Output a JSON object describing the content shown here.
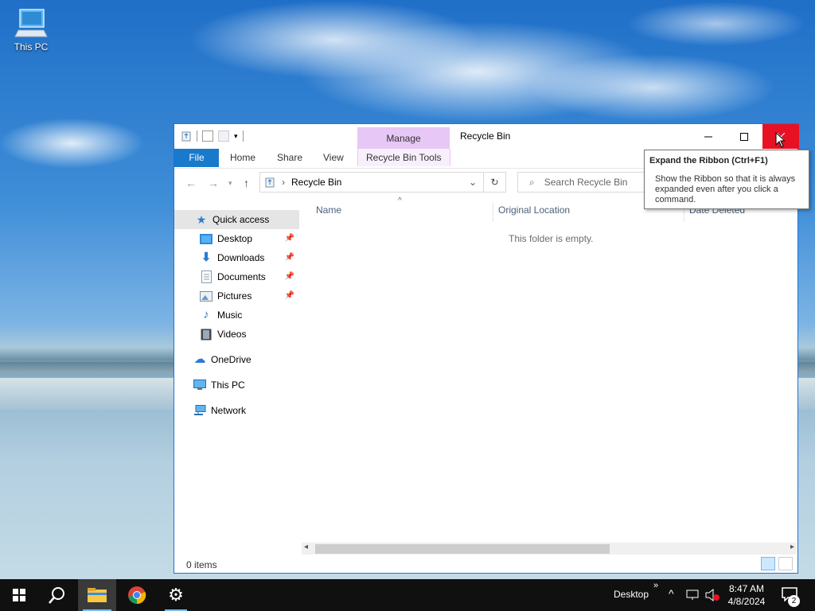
{
  "desktop": {
    "icons": [
      {
        "label": "This PC",
        "icon": "computer-icon"
      }
    ]
  },
  "window": {
    "title": "Recycle Bin",
    "context_tab": "Manage",
    "ribbon_tabs": [
      "File",
      "Home",
      "Share",
      "View",
      "Recycle Bin Tools"
    ],
    "address_path": "Recycle Bin",
    "search_placeholder": "Search Recycle Bin",
    "nav": {
      "quick_access": "Quick access",
      "items": [
        {
          "label": "Desktop",
          "icon": "desktop-folder-icon",
          "pinned": true
        },
        {
          "label": "Downloads",
          "icon": "downloads-icon",
          "pinned": true
        },
        {
          "label": "Documents",
          "icon": "documents-icon",
          "pinned": true
        },
        {
          "label": "Pictures",
          "icon": "pictures-icon",
          "pinned": true
        },
        {
          "label": "Music",
          "icon": "music-icon",
          "pinned": false
        },
        {
          "label": "Videos",
          "icon": "videos-icon",
          "pinned": false
        }
      ],
      "onedrive": "OneDrive",
      "this_pc": "This PC",
      "network": "Network"
    },
    "columns": [
      "Name",
      "Original Location",
      "Date Deleted"
    ],
    "empty_message": "This folder is empty.",
    "status": "0 items",
    "tooltip": {
      "title": "Expand the Ribbon (Ctrl+F1)",
      "body": "Show the Ribbon so that it is always expanded even after you click a command."
    }
  },
  "taskbar": {
    "desktop_label": "Desktop",
    "time": "8:47 AM",
    "date": "4/8/2024",
    "notification_count": "2",
    "pinned_apps": [
      "file-explorer-icon",
      "chrome-icon",
      "settings-icon"
    ]
  },
  "colors": {
    "accent": "#1979ca",
    "close": "#e81123",
    "manage_tab": "#e7c7f6"
  }
}
